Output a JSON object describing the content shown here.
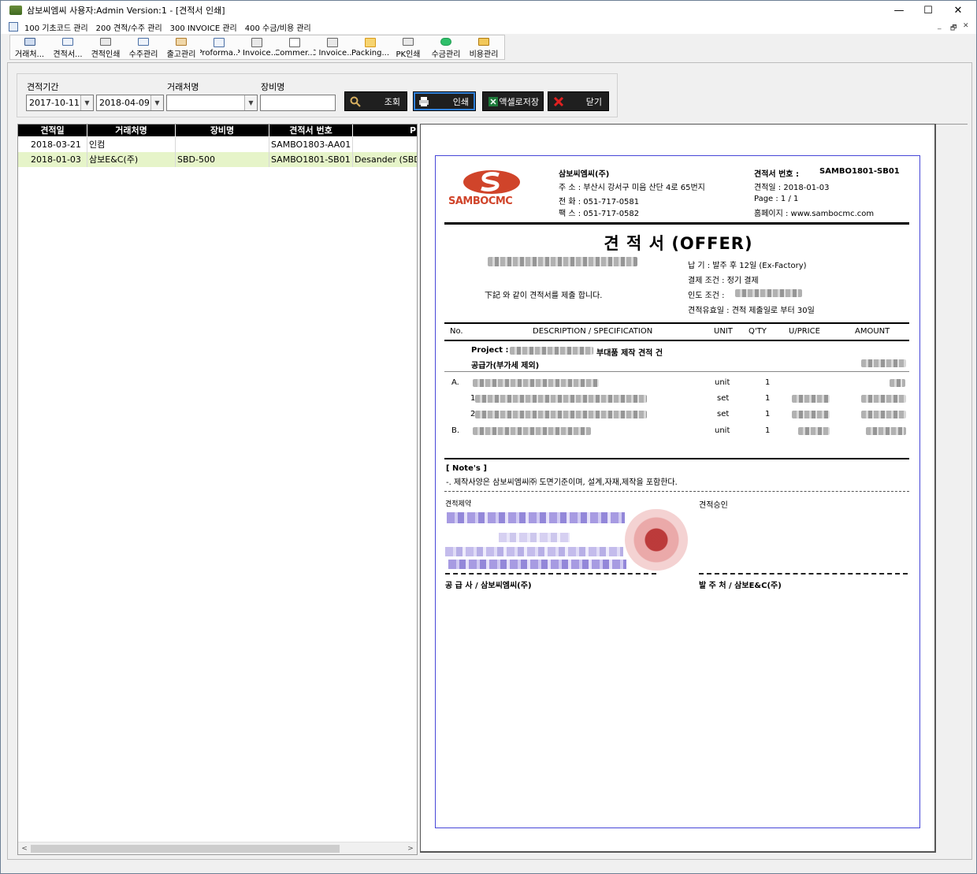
{
  "window": {
    "title": "삼보씨엠씨 사용자:Admin Version:1 - [견적서 인쇄]",
    "min_glyph": "—",
    "max_glyph": "☐",
    "close_glyph": "✕"
  },
  "menu": {
    "items": [
      "100 기초코드 관리",
      "200 견적/수주 관리",
      "300 INVOICE 관리",
      "400 수금/비용 관리"
    ],
    "mdi_min": "_",
    "mdi_restore": "🗗",
    "mdi_close": "✕"
  },
  "toolbar": {
    "buttons": [
      {
        "label": "거래처...",
        "icon": "building-icon",
        "color": "#3a5a8c"
      },
      {
        "label": "견적서...",
        "icon": "document-icon",
        "color": "#4a6fa5"
      },
      {
        "label": "견적인쇄",
        "icon": "printer-icon",
        "color": "#666666"
      },
      {
        "label": "수주관리",
        "icon": "document-icon",
        "color": "#4a6fa5"
      },
      {
        "label": "출고관리",
        "icon": "box-icon",
        "color": "#b07a2a"
      },
      {
        "label": "Proforma...",
        "icon": "document-icon",
        "color": "#4a6fa5"
      },
      {
        "label": "P Invoice...",
        "icon": "printer-icon",
        "color": "#666666"
      },
      {
        "label": "Commer...",
        "icon": "page-icon",
        "color": "#666666"
      },
      {
        "label": "C Invoice...",
        "icon": "printer-icon",
        "color": "#666666"
      },
      {
        "label": "Packing...",
        "icon": "package-icon",
        "color": "#d89a1a"
      },
      {
        "label": "PK인쇄",
        "icon": "printer-icon",
        "color": "#666666"
      },
      {
        "label": "수금관리",
        "icon": "money-icon",
        "color": "#2fbf6a"
      },
      {
        "label": "비용관리",
        "icon": "folder-icon",
        "color": "#d8a020"
      }
    ]
  },
  "filter": {
    "period_label": "견적기간",
    "date_from": "2017-10-11",
    "date_to": "2018-04-09",
    "client_label": "거래처명",
    "client_value": "",
    "equipment_label": "장비명",
    "equipment_value": "",
    "search_btn": "조회",
    "print_btn": "인쇄",
    "excel_btn": "액셀로저장",
    "close_btn": "닫기",
    "dropdown_glyph": "▼"
  },
  "grid": {
    "columns": [
      "견적일",
      "거래처명",
      "장비명",
      "견적서 번호",
      "P"
    ],
    "rows": [
      {
        "date": "2018-03-21",
        "client": "인컴",
        "equipment": "",
        "quote_no": "SAMBO1803-AA01",
        "project": ""
      },
      {
        "date": "2018-01-03",
        "client": "삼보E&C(주)",
        "equipment": "SBD-500",
        "quote_no": "SAMBO1801-SB01",
        "project": "Desander (SBD-"
      }
    ],
    "scroll_left": "<",
    "scroll_right": ">"
  },
  "report": {
    "logo_text": "SAMBOCMC",
    "company": "삼보씨엠씨(주)",
    "address": "주 소 : 부산시 강서구 미음 산단 4로 65번지",
    "phone": "전 화 : 051-717-0581",
    "fax": "팩 스 : 051-717-0582",
    "quote_no_label": "견적서 번호 :",
    "quote_no": "SAMBO1801-SB01",
    "quote_date": "견적일 : 2018-01-03",
    "page": "Page : 1 / 1",
    "homepage": "홈페이지 : www.sambocmc.com",
    "title": "견 적 서 (OFFER)",
    "intro": "下記 와 같이 견적서를 제출 합니다.",
    "delivery": "납 기 : 발주 후 12일 (Ex-Factory)",
    "payment": "결제 조건 : 정기 결제",
    "handover_label": "인도 조건 :",
    "validity": "견적유효일 : 견적 제출일로 부터 30일",
    "col_no": "No.",
    "col_desc": "DESCRIPTION / SPECIFICATION",
    "col_unit": "UNIT",
    "col_qty": "Q'TY",
    "col_uprice": "U/PRICE",
    "col_amount": "AMOUNT",
    "project_label": "Project :",
    "project_suffix": "부대품 제작 견적 건",
    "supply_label": "공급가(부가세 제외)",
    "items": [
      {
        "no": "A.",
        "unit": "unit",
        "qty": "1"
      },
      {
        "no": "1",
        "unit": "set",
        "qty": "1"
      },
      {
        "no": "2",
        "unit": "set",
        "qty": "1"
      },
      {
        "no": "B.",
        "unit": "unit",
        "qty": "1"
      }
    ],
    "notes_title": "[ Note's ]",
    "notes_text": "-. 제작사양은 삼보씨엠씨㈜ 도면기준이며, 설계,자재,제작을 포함한다.",
    "sign_offer": "견적제약",
    "sign_approve": "견적승인",
    "supplier": "공 급 사 / 삼보씨엠씨(주)",
    "orderer": "발 주 처 /  삼보E&C(주)"
  }
}
